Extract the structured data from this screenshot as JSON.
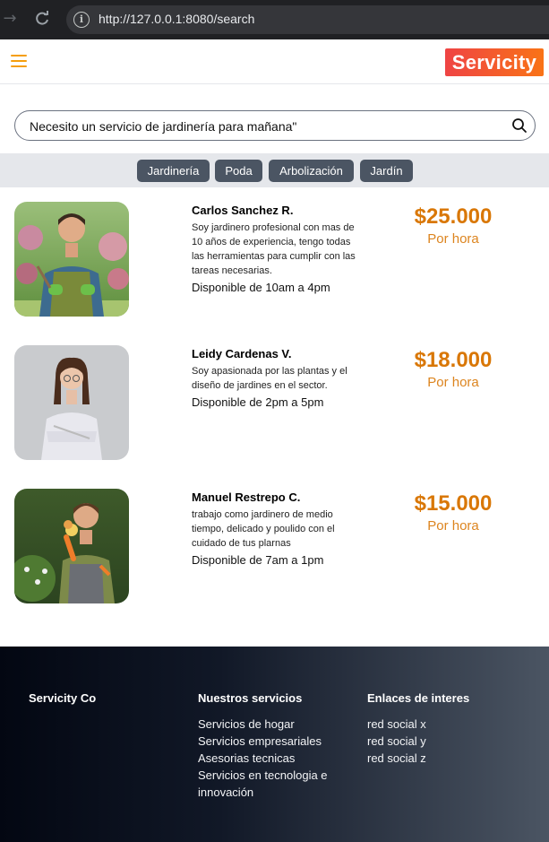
{
  "browser": {
    "url": "http://127.0.0.1:8080/search"
  },
  "header": {
    "logo_text": "Servicity"
  },
  "search": {
    "value": "Necesito un servicio de jardinería para mañana\""
  },
  "tags": [
    "Jardinería",
    "Poda",
    "Arbolización",
    "Jardín"
  ],
  "results": [
    {
      "name": "Carlos Sanchez R.",
      "description": "Soy jardinero profesional con mas de 10 años de experiencia, tengo todas las herramientas para cumplir con las tareas necesarias.",
      "availability": "Disponible de 10am a 4pm",
      "price": "$25.000",
      "unit": "Por hora"
    },
    {
      "name": "Leidy Cardenas V.",
      "description": "Soy apasionada por las plantas y el diseño de jardines en el sector.",
      "availability": "Disponible de 2pm a 5pm",
      "price": "$18.000",
      "unit": "Por hora"
    },
    {
      "name": "Manuel Restrepo C.",
      "description": "trabajo como jardinero de medio tiempo, delicado y poulido con el cuidado de tus plarnas",
      "availability": "Disponible de 7am a 1pm",
      "price": "$15.000",
      "unit": "Por hora"
    }
  ],
  "footer": {
    "brand": "Servicity Co",
    "services_title": "Nuestros servicios",
    "services": [
      "Servicios de hogar",
      "Servicios empresariales",
      "Asesorias tecnicas",
      "Servicios en tecnologia e innovación"
    ],
    "links_title": "Enlaces de interes",
    "links": [
      "red social x",
      "red social y",
      "red social z"
    ]
  },
  "colors": {
    "accent": "#d97706",
    "logo_start": "#ef4444",
    "logo_end": "#f97316",
    "tag_bg": "#4b5563"
  }
}
